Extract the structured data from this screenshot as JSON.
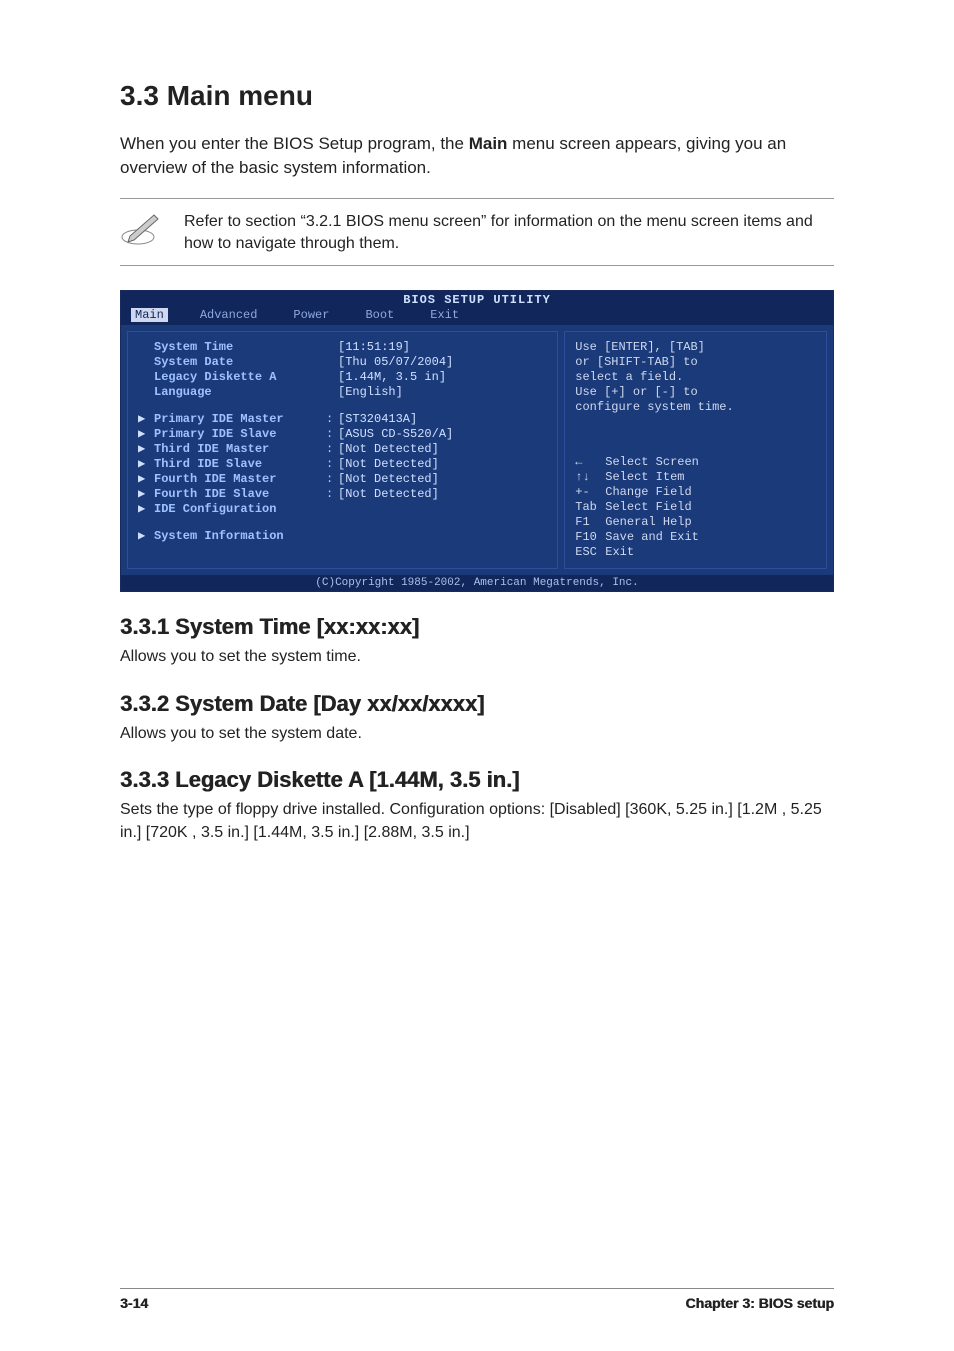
{
  "heading": "3.3   Main menu",
  "intro_before_bold": "When you enter the BIOS Setup program, the ",
  "intro_bold": "Main",
  "intro_after_bold": " menu screen appears, giving you an overview of the basic system information.",
  "note": "Refer to section “3.2.1  BIOS menu screen” for information on the menu screen items and how to navigate through them.",
  "bios": {
    "title": "BIOS SETUP UTILITY",
    "tabs": [
      "Main",
      "Advanced",
      "Power",
      "Boot",
      "Exit"
    ],
    "selected_tab": "Main",
    "rows_top": [
      {
        "label": "System Time",
        "val": "[11:51:19]"
      },
      {
        "label": "System Date",
        "val": "[Thu 05/07/2004]"
      },
      {
        "label": "Legacy Diskette A",
        "val": "[1.44M, 3.5 in]"
      },
      {
        "label": "Language",
        "val": "[English]"
      }
    ],
    "rows_mid": [
      {
        "label": "Primary IDE Master",
        "sep": ":",
        "val": "[ST320413A]"
      },
      {
        "label": "Primary IDE Slave",
        "sep": ":",
        "val": "[ASUS CD-S520/A]"
      },
      {
        "label": "Third IDE Master",
        "sep": ":",
        "val": "[Not Detected]"
      },
      {
        "label": "Third IDE Slave",
        "sep": ":",
        "val": "[Not Detected]"
      },
      {
        "label": "Fourth IDE Master",
        "sep": ":",
        "val": "[Not Detected]"
      },
      {
        "label": "Fourth IDE Slave",
        "sep": ":",
        "val": "[Not Detected]"
      },
      {
        "label": "IDE Configuration",
        "sep": "",
        "val": ""
      }
    ],
    "rows_bot": [
      {
        "label": "System Information",
        "sep": "",
        "val": ""
      }
    ],
    "help_top": [
      "Use [ENTER], [TAB]",
      "or [SHIFT-TAB] to",
      "select a field.",
      "",
      "Use [+] or [-] to",
      "configure system time."
    ],
    "keys": [
      {
        "k": "←",
        "d": "Select Screen"
      },
      {
        "k": "↑↓",
        "d": "Select Item"
      },
      {
        "k": "+-",
        "d": "Change Field"
      },
      {
        "k": "Tab",
        "d": "Select Field"
      },
      {
        "k": "F1",
        "d": "General Help"
      },
      {
        "k": "F10",
        "d": "Save and Exit"
      },
      {
        "k": "ESC",
        "d": "Exit"
      }
    ],
    "copyright": "(C)Copyright 1985-2002, American Megatrends, Inc."
  },
  "sections": [
    {
      "h": "3.3.1   System Time [xx:xx:xx]",
      "p": "Allows you to set the system time."
    },
    {
      "h": "3.3.2   System Date [Day xx/xx/xxxx]",
      "p": "Allows you to set the system date."
    },
    {
      "h": "3.3.3   Legacy Diskette A [1.44M, 3.5 in.]",
      "p": "Sets the type of floppy drive installed. Configuration options: [Disabled] [360K, 5.25 in.] [1.2M , 5.25 in.] [720K , 3.5 in.] [1.44M, 3.5 in.] [2.88M, 3.5 in.]"
    }
  ],
  "footer": {
    "left": "3-14",
    "right": "Chapter 3: BIOS setup"
  }
}
